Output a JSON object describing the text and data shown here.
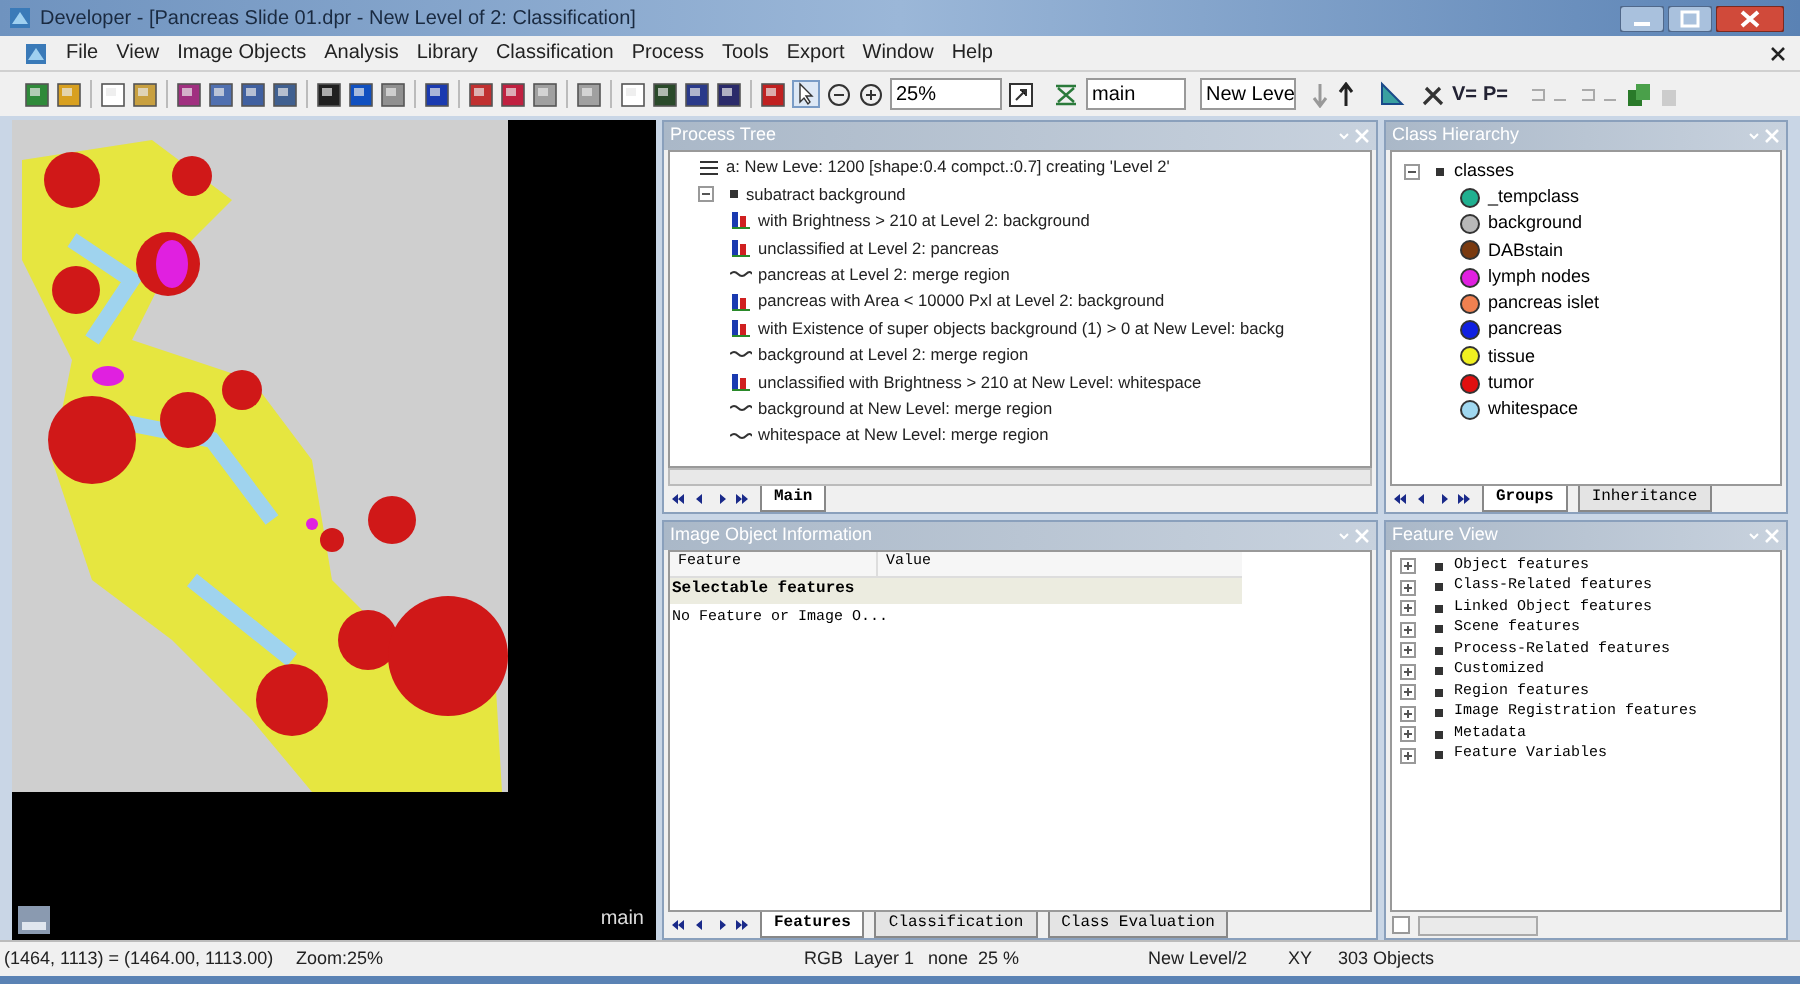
{
  "window": {
    "title": "Developer - [Pancreas Slide 01.dpr - New Level of 2: Classification]"
  },
  "menu": [
    "File",
    "View",
    "Image Objects",
    "Analysis",
    "Library",
    "Classification",
    "Process",
    "Tools",
    "Export",
    "Window",
    "Help"
  ],
  "toolbar": {
    "zoom": "25%",
    "image_layer": "main",
    "level": "New Leve",
    "labels": [
      "V=",
      "P="
    ]
  },
  "viewer": {
    "label": "main"
  },
  "process_tree": {
    "title": "Process Tree",
    "items": [
      {
        "kind": "segment",
        "text": "a: New Leve: 1200 [shape:0.4 compct.:0.7] creating 'Level 2'"
      },
      {
        "kind": "folder",
        "text": "subatract background",
        "expanded": true,
        "children": [
          {
            "kind": "classify",
            "text": "with Brightness > 210  at  Level 2: background"
          },
          {
            "kind": "classify",
            "text": "unclassified at  Level 2: pancreas"
          },
          {
            "kind": "merge",
            "text": "pancreas at  Level 2: merge region"
          },
          {
            "kind": "classify",
            "text": "pancreas with Area < 10000 Pxl at  Level 2: background"
          },
          {
            "kind": "classify",
            "text": "with Existence of super objects background (1) > 0  at  New Level: backg"
          },
          {
            "kind": "merge",
            "text": "background at  Level 2: merge region"
          },
          {
            "kind": "classify",
            "text": "unclassified with Brightness > 210  at  New Level: whitespace"
          },
          {
            "kind": "merge",
            "text": "background at  New Level: merge region"
          },
          {
            "kind": "merge",
            "text": "whitespace at  New Level: merge region"
          }
        ]
      }
    ],
    "tabs": [
      {
        "label": "Main",
        "selected": true
      }
    ]
  },
  "class_hierarchy": {
    "title": "Class Hierarchy",
    "root": "classes",
    "classes": [
      {
        "name": "_tempclass",
        "color": "#20b090"
      },
      {
        "name": "background",
        "color": "#b8b8b8"
      },
      {
        "name": "DABstain",
        "color": "#7a3a10"
      },
      {
        "name": "lymph nodes",
        "color": "#e020e0"
      },
      {
        "name": "pancreas islet",
        "color": "#f08050"
      },
      {
        "name": "pancreas",
        "color": "#1020e0"
      },
      {
        "name": "tissue",
        "color": "#f0f020"
      },
      {
        "name": "tumor",
        "color": "#e01010"
      },
      {
        "name": "whitespace",
        "color": "#a0d8f0"
      }
    ],
    "tabs": [
      {
        "label": "Groups",
        "selected": true
      },
      {
        "label": "Inheritance",
        "selected": false
      }
    ]
  },
  "image_object_info": {
    "title": "Image Object Information",
    "columns": [
      "Feature",
      "Value"
    ],
    "group": "Selectable features",
    "rows": [
      "No Feature or Image O..."
    ],
    "tabs": [
      {
        "label": "Features",
        "selected": true
      },
      {
        "label": "Classification",
        "selected": false
      },
      {
        "label": "Class Evaluation",
        "selected": false
      }
    ]
  },
  "feature_view": {
    "title": "Feature View",
    "items": [
      "Object features",
      "Class-Related features",
      "Linked Object features",
      "Scene features",
      "Process-Related features",
      "Customized",
      "Region features",
      "Image Registration features",
      "Metadata",
      "Feature Variables"
    ],
    "checkbox_checked": false
  },
  "status_bar": {
    "position": "(1464, 1113) = (1464.00, 1113.00)",
    "zoom": "Zoom:25%",
    "fields": [
      "RGB",
      "Layer 1",
      "none",
      "25 %",
      "New Level/2",
      "XY",
      "303 Objects"
    ]
  }
}
